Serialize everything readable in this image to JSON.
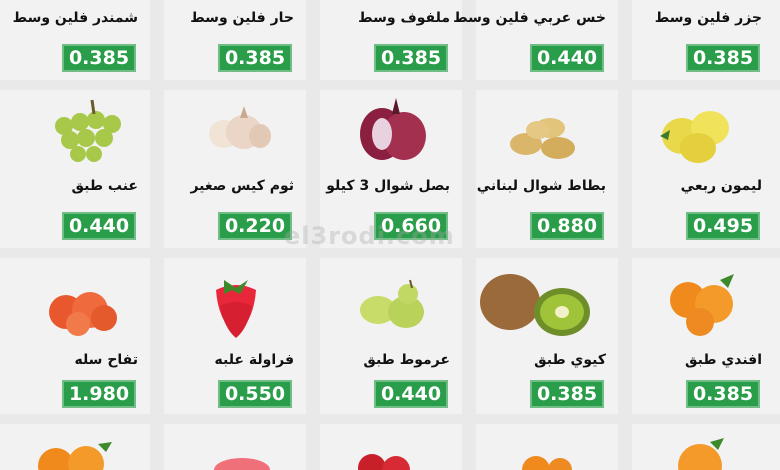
{
  "watermark": "el3rodi.com",
  "colors": {
    "price_bg": "#2a9d4a",
    "price_text": "#ffffff",
    "page_bg": "#f2f2f2"
  },
  "rows": [
    {
      "items": [
        {
          "name": "جزر فلين وسط",
          "price": "0.385",
          "icon": "carrot-icon"
        },
        {
          "name": "خس عربي فلين وسط",
          "price": "0.440",
          "icon": "lettuce-icon"
        },
        {
          "name": "ملفوف وسط",
          "price": "0.385",
          "icon": "cabbage-icon"
        },
        {
          "name": "حار فلين وسط",
          "price": "0.385",
          "icon": "chili-icon"
        },
        {
          "name": "شمندر فلين وسط",
          "price": "0.385",
          "icon": "beetroot-icon"
        }
      ]
    },
    {
      "items": [
        {
          "name": "ليمون ربعي",
          "price": "0.495",
          "icon": "lemon-icon"
        },
        {
          "name": "بطاط شوال لبناني",
          "price": "0.880",
          "icon": "potato-icon"
        },
        {
          "name": "بصل شوال 3 كيلو",
          "price": "0.660",
          "icon": "red-onion-icon"
        },
        {
          "name": "ثوم كيس صغير",
          "price": "0.220",
          "icon": "garlic-icon"
        },
        {
          "name": "عنب طبق",
          "price": "0.440",
          "icon": "grapes-icon"
        }
      ]
    },
    {
      "items": [
        {
          "name": "افندي طبق",
          "price": "0.385",
          "icon": "tangerine-icon"
        },
        {
          "name": "كيوي طبق",
          "price": "0.385",
          "icon": "kiwi-icon"
        },
        {
          "name": "عرموط طبق",
          "price": "0.440",
          "icon": "pear-icon"
        },
        {
          "name": "فراولة علبه",
          "price": "0.550",
          "icon": "strawberry-icon"
        },
        {
          "name": "تفاح سله",
          "price": "1.980",
          "icon": "apple-icon"
        }
      ]
    }
  ]
}
